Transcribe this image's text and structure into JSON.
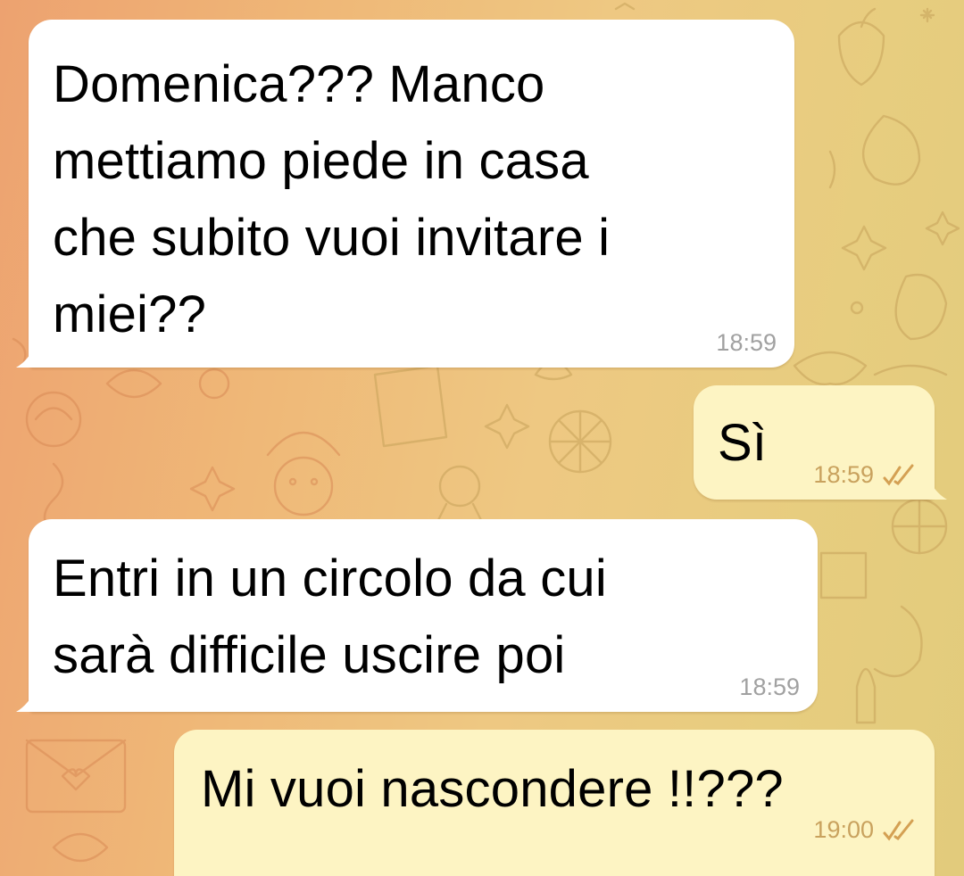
{
  "theme": {
    "incoming_bubble": "#ffffff",
    "outgoing_bubble": "#fdf4c3",
    "read_check_color": "#d4a053",
    "background_pattern": "christmas-doodles"
  },
  "messages": [
    {
      "direction": "incoming",
      "text": "Domenica??? Manco\nmettiamo piede in casa\nche subito vuoi invitare i\nmiei??",
      "time": "18:59"
    },
    {
      "direction": "outgoing",
      "text": "Sì",
      "time": "18:59",
      "status_icon": "double-check-icon"
    },
    {
      "direction": "incoming",
      "text": "Entri in un circolo da cui\nsarà difficile uscire poi",
      "time": "18:59"
    },
    {
      "direction": "outgoing",
      "text": "Mi vuoi nascondere !!???",
      "time": "19:00",
      "status_icon": "double-check-icon"
    }
  ]
}
